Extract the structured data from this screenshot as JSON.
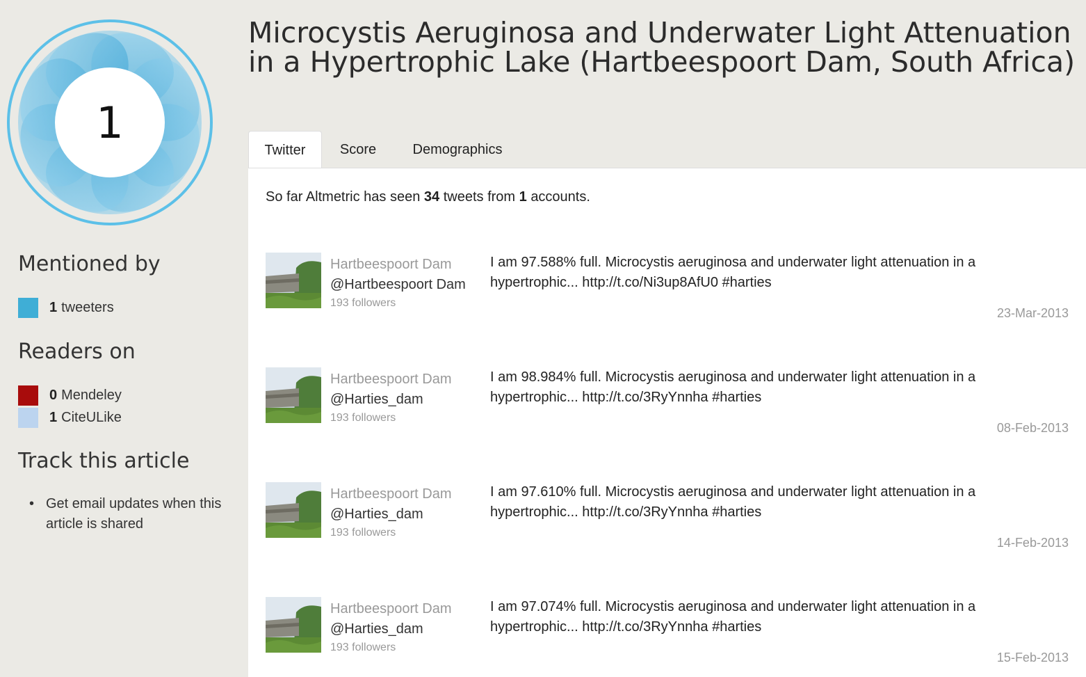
{
  "score": "1",
  "title": "Microcystis Aeruginosa and Underwater Light Attenuation in a Hypertrophic Lake (Hartbeespoort Dam, South Africa)",
  "sidebar": {
    "mentioned_heading": "Mentioned by",
    "mentioned": [
      {
        "count": "1",
        "label": "tweeters",
        "color": "#3faed6"
      }
    ],
    "readers_heading": "Readers on",
    "readers": [
      {
        "count": "0",
        "label": "Mendeley",
        "color": "#a80c0c"
      },
      {
        "count": "1",
        "label": "CiteULike",
        "color": "#bcd4ef"
      }
    ],
    "track_heading": "Track this article",
    "track_items": [
      "Get email updates when this article is shared"
    ]
  },
  "tabs": [
    {
      "label": "Twitter",
      "active": true
    },
    {
      "label": "Score",
      "active": false
    },
    {
      "label": "Demographics",
      "active": false
    }
  ],
  "summary": {
    "prefix": "So far Altmetric has seen",
    "tweets": "34",
    "middle": "tweets from",
    "accounts": "1",
    "suffix": "accounts."
  },
  "tweets": [
    {
      "name": "Hartbeespoort Dam",
      "handle": "@Hartbeespoort Dam",
      "followers": "193 followers",
      "text": "I am 97.588% full. Microcystis aeruginosa and underwater light attenuation in a hypertrophic...",
      "link": "http://t.co/Ni3up8AfU0",
      "hashtag": "#harties",
      "date": "23-Mar-2013"
    },
    {
      "name": "Hartbeespoort Dam",
      "handle": "@Harties_dam",
      "followers": "193 followers",
      "text": "I am 98.984% full. Microcystis aeruginosa and underwater light attenuation in a hypertrophic...",
      "link": "http://t.co/3RyYnnha",
      "hashtag": "#harties",
      "date": "08-Feb-2013"
    },
    {
      "name": "Hartbeespoort Dam",
      "handle": "@Harties_dam",
      "followers": "193 followers",
      "text": "I am 97.610% full. Microcystis aeruginosa and underwater light attenuation in a hypertrophic...",
      "link": "http://t.co/3RyYnnha",
      "hashtag": "#harties",
      "date": "14-Feb-2013"
    },
    {
      "name": "Hartbeespoort Dam",
      "handle": "@Harties_dam",
      "followers": "193 followers",
      "text": "I am 97.074% full. Microcystis aeruginosa and underwater light attenuation in a hypertrophic...",
      "link": "http://t.co/3RyYnnha",
      "hashtag": "#harties",
      "date": "15-Feb-2013"
    }
  ]
}
